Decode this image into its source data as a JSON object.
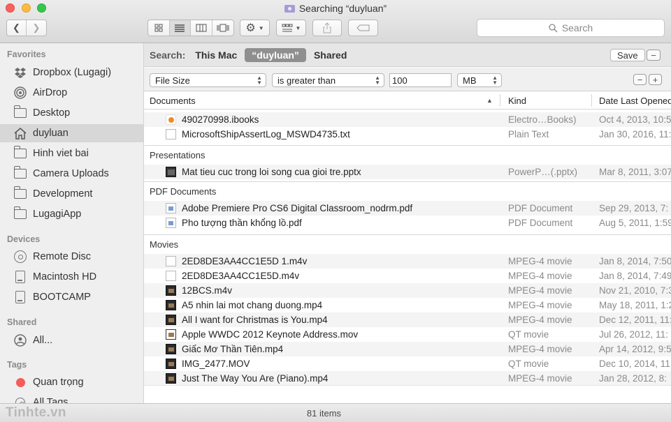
{
  "window": {
    "title": "Searching “duyluan”"
  },
  "toolbar": {
    "search_placeholder": "Search"
  },
  "sidebar": {
    "favorites_header": "Favorites",
    "favorites": [
      "Dropbox (Lugagi)",
      "AirDrop",
      "Desktop",
      "duyluan",
      "Hinh viet bai",
      "Camera Uploads",
      "Development",
      "LugagiApp"
    ],
    "devices_header": "Devices",
    "devices": [
      "Remote Disc",
      "Macintosh HD",
      "BOOTCAMP"
    ],
    "shared_header": "Shared",
    "shared": [
      "All..."
    ],
    "tags_header": "Tags",
    "tags": [
      "Quan trọng",
      "All Tags..."
    ]
  },
  "scope": {
    "label": "Search:",
    "this_mac": "This Mac",
    "folder": "“duyluan”",
    "shared": "Shared",
    "save": "Save",
    "minus": "−"
  },
  "criteria": {
    "attribute": "File Size",
    "operator": "is greater than",
    "value": "100",
    "unit": "MB",
    "minus": "−",
    "plus": "+"
  },
  "columns": {
    "name": "Documents",
    "kind": "Kind",
    "date": "Date Last Opened"
  },
  "groups": {
    "documents": [
      {
        "name": "490270998.ibooks",
        "kind": "Electro…Books)",
        "date": "Oct 4, 2013, 10:5"
      },
      {
        "name": "MicrosoftShipAssertLog_MSWD4735.txt",
        "kind": "Plain Text",
        "date": "Jan 30, 2016, 11:"
      }
    ],
    "presentations_label": "Presentations",
    "presentations": [
      {
        "name": "Mat tieu cuc trong loi song cua gioi tre.pptx",
        "kind": "PowerP…(.pptx)",
        "date": "Mar 8, 2011, 3:07"
      }
    ],
    "pdf_label": "PDF Documents",
    "pdf": [
      {
        "name": "Adobe Premiere Pro CS6 Digital Classroom_nodrm.pdf",
        "kind": "PDF Document",
        "date": "Sep 29, 2013, 7:"
      },
      {
        "name": "Pho tượng thần khổng lồ.pdf",
        "kind": "PDF Document",
        "date": "Aug 5, 2011, 1:59"
      }
    ],
    "movies_label": "Movies",
    "movies": [
      {
        "name": "2ED8DE3AA4CC1E5D 1.m4v",
        "kind": "MPEG-4 movie",
        "date": "Jan 8, 2014, 7:50",
        "icon": "doc"
      },
      {
        "name": "2ED8DE3AA4CC1E5D.m4v",
        "kind": "MPEG-4 movie",
        "date": "Jan 8, 2014, 7:49",
        "icon": "doc"
      },
      {
        "name": "12BCS.m4v",
        "kind": "MPEG-4 movie",
        "date": "Nov 21, 2010, 7:3",
        "icon": "vid"
      },
      {
        "name": "A5 nhin lai mot chang duong.mp4",
        "kind": "MPEG-4 movie",
        "date": "May 18, 2011, 1:2",
        "icon": "vid"
      },
      {
        "name": "All I want for Christmas is You.mp4",
        "kind": "MPEG-4 movie",
        "date": "Dec 12, 2011, 11:",
        "icon": "vid"
      },
      {
        "name": "Apple WWDC 2012 Keynote Address.mov",
        "kind": "QT movie",
        "date": "Jul 26, 2012, 11:",
        "icon": "vid"
      },
      {
        "name": "Giấc Mơ Thần Tiên.mp4",
        "kind": "MPEG-4 movie",
        "date": "Apr 14, 2012, 9:5",
        "icon": "vid"
      },
      {
        "name": "IMG_2477.MOV",
        "kind": "QT movie",
        "date": "Dec 10, 2014, 11:",
        "icon": "vid"
      },
      {
        "name": "Just The Way You Are (Piano).mp4",
        "kind": "MPEG-4 movie",
        "date": "Jan 28, 2012, 8:",
        "icon": "vid"
      }
    ]
  },
  "status": {
    "count": "81 items",
    "watermark": "Tinhte.vn"
  }
}
